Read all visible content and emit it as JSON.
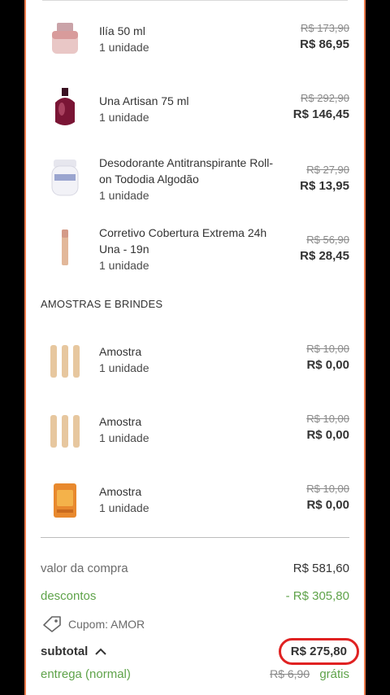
{
  "items": [
    {
      "name": "Ilía 50 ml",
      "qty": "1 unidade",
      "old_price": "R$ 173,90",
      "price": "R$ 86,95",
      "icon": "perfume-bottle-pink"
    },
    {
      "name": "Una Artisan 75 ml",
      "qty": "1 unidade",
      "old_price": "R$ 292,90",
      "price": "R$ 146,45",
      "icon": "perfume-bottle-burgundy"
    },
    {
      "name": "Desodorante Antitranspirante Roll-on Tododia Algodão",
      "qty": "1 unidade",
      "old_price": "R$ 27,90",
      "price": "R$ 13,95",
      "icon": "rollon-deodorant"
    },
    {
      "name": "Corretivo Cobertura Extrema 24h Una - 19n",
      "qty": "1 unidade",
      "old_price": "R$ 56,90",
      "price": "R$ 28,45",
      "icon": "concealer-tube"
    }
  ],
  "samples_title": "AMOSTRAS E BRINDES",
  "samples": [
    {
      "name": "Amostra",
      "qty": "1 unidade",
      "old_price": "R$ 10,00",
      "price": "R$ 0,00",
      "icon": "sample-vials"
    },
    {
      "name": "Amostra",
      "qty": "1 unidade",
      "old_price": "R$ 10,00",
      "price": "R$ 0,00",
      "icon": "sample-vials"
    },
    {
      "name": "Amostra",
      "qty": "1 unidade",
      "old_price": "R$ 10,00",
      "price": "R$ 0,00",
      "icon": "sample-sachet"
    }
  ],
  "summary": {
    "purchase_label": "valor da compra",
    "purchase_value": "R$ 581,60",
    "discount_label": "descontos",
    "discount_value": "- R$ 305,80",
    "coupon_label": "Cupom: AMOR",
    "subtotal_label": "subtotal",
    "subtotal_value": "R$ 275,80",
    "shipping_label": "entrega (normal)",
    "shipping_old": "R$ 6,90",
    "shipping_value": "grátis"
  },
  "colors": {
    "border": "#f07a4b",
    "green": "#5fa34a",
    "highlight": "#e02222"
  }
}
